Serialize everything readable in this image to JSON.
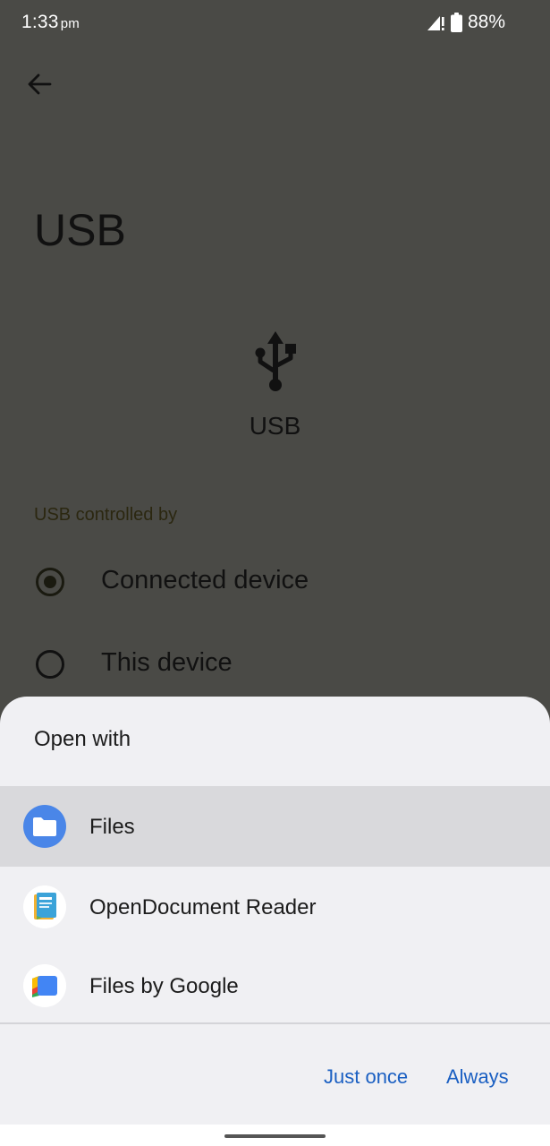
{
  "status_bar": {
    "time": "1:33",
    "ampm": "pm",
    "battery": "88%",
    "icons": [
      "signal-icon",
      "battery-icon"
    ]
  },
  "page": {
    "title": "USB",
    "hero_label": "USB",
    "hero_icon": "usb-icon",
    "section_header": "USB controlled by",
    "options": [
      {
        "label": "Connected device",
        "checked": true
      },
      {
        "label": "This device",
        "checked": false
      }
    ]
  },
  "sheet": {
    "title": "Open with",
    "apps": [
      {
        "label": "Files",
        "icon": "files-folder-icon",
        "selected": true
      },
      {
        "label": "OpenDocument Reader",
        "icon": "opendocument-reader-icon",
        "selected": false
      },
      {
        "label": "Files by Google",
        "icon": "files-by-google-icon",
        "selected": false
      }
    ],
    "actions": {
      "just_once": "Just once",
      "always": "Always"
    }
  },
  "colors": {
    "scrim_background": "#4a4a46",
    "sheet_background": "#f0f0f3",
    "selected_row": "#d9d9dc",
    "accent_text": "#1a5fc2"
  }
}
